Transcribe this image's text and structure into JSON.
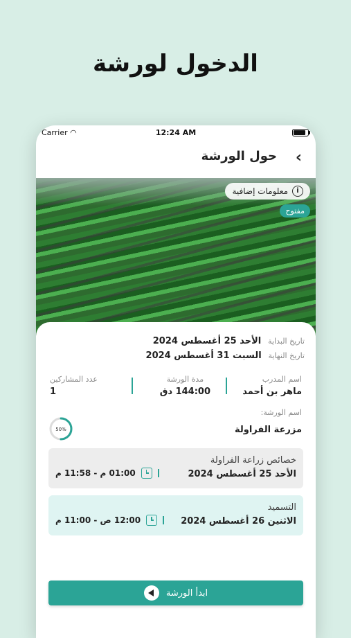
{
  "headline": "الدخول لورشة",
  "statusbar": {
    "carrier": "Carrier",
    "time": "12:24 AM"
  },
  "nav": {
    "title": "حول الورشة",
    "back_glyph": "›"
  },
  "hero": {
    "more_info_label": "معلومات إضافية",
    "status_badge": "مفتوح"
  },
  "dates": {
    "start_label": "تاريخ البداية",
    "start_value": "الأحد 25 أغسطس 2024",
    "end_label": "تاريخ النهاية",
    "end_value": "السبت 31 أغسطس 2024"
  },
  "stats": {
    "trainer_label": "اسم المدرب",
    "trainer_value": "ماهر بن أحمد",
    "duration_label": "مدة الورشة",
    "duration_value": "144:00 دق",
    "participants_label": "عدد المشاركين",
    "participants_value": "1"
  },
  "workshop": {
    "name_label": "اسم الورشة:",
    "name_value": "مزرعة الفراولة",
    "progress_label": "50%",
    "progress_fraction": 0.5
  },
  "sessions": [
    {
      "title": "خصائص زراعة الفراولة",
      "date": "الأحد 25 أغسطس 2024",
      "time": "01:00 م - 11:58 م"
    },
    {
      "title": "التسميد",
      "date": "الاثنين 26 أغسطس 2024",
      "time": "12:00 ص - 11:00 م"
    }
  ],
  "start_button_label": "ابدأ الورشة",
  "colors": {
    "accent": "#2ba496",
    "background": "#d8eee6"
  }
}
